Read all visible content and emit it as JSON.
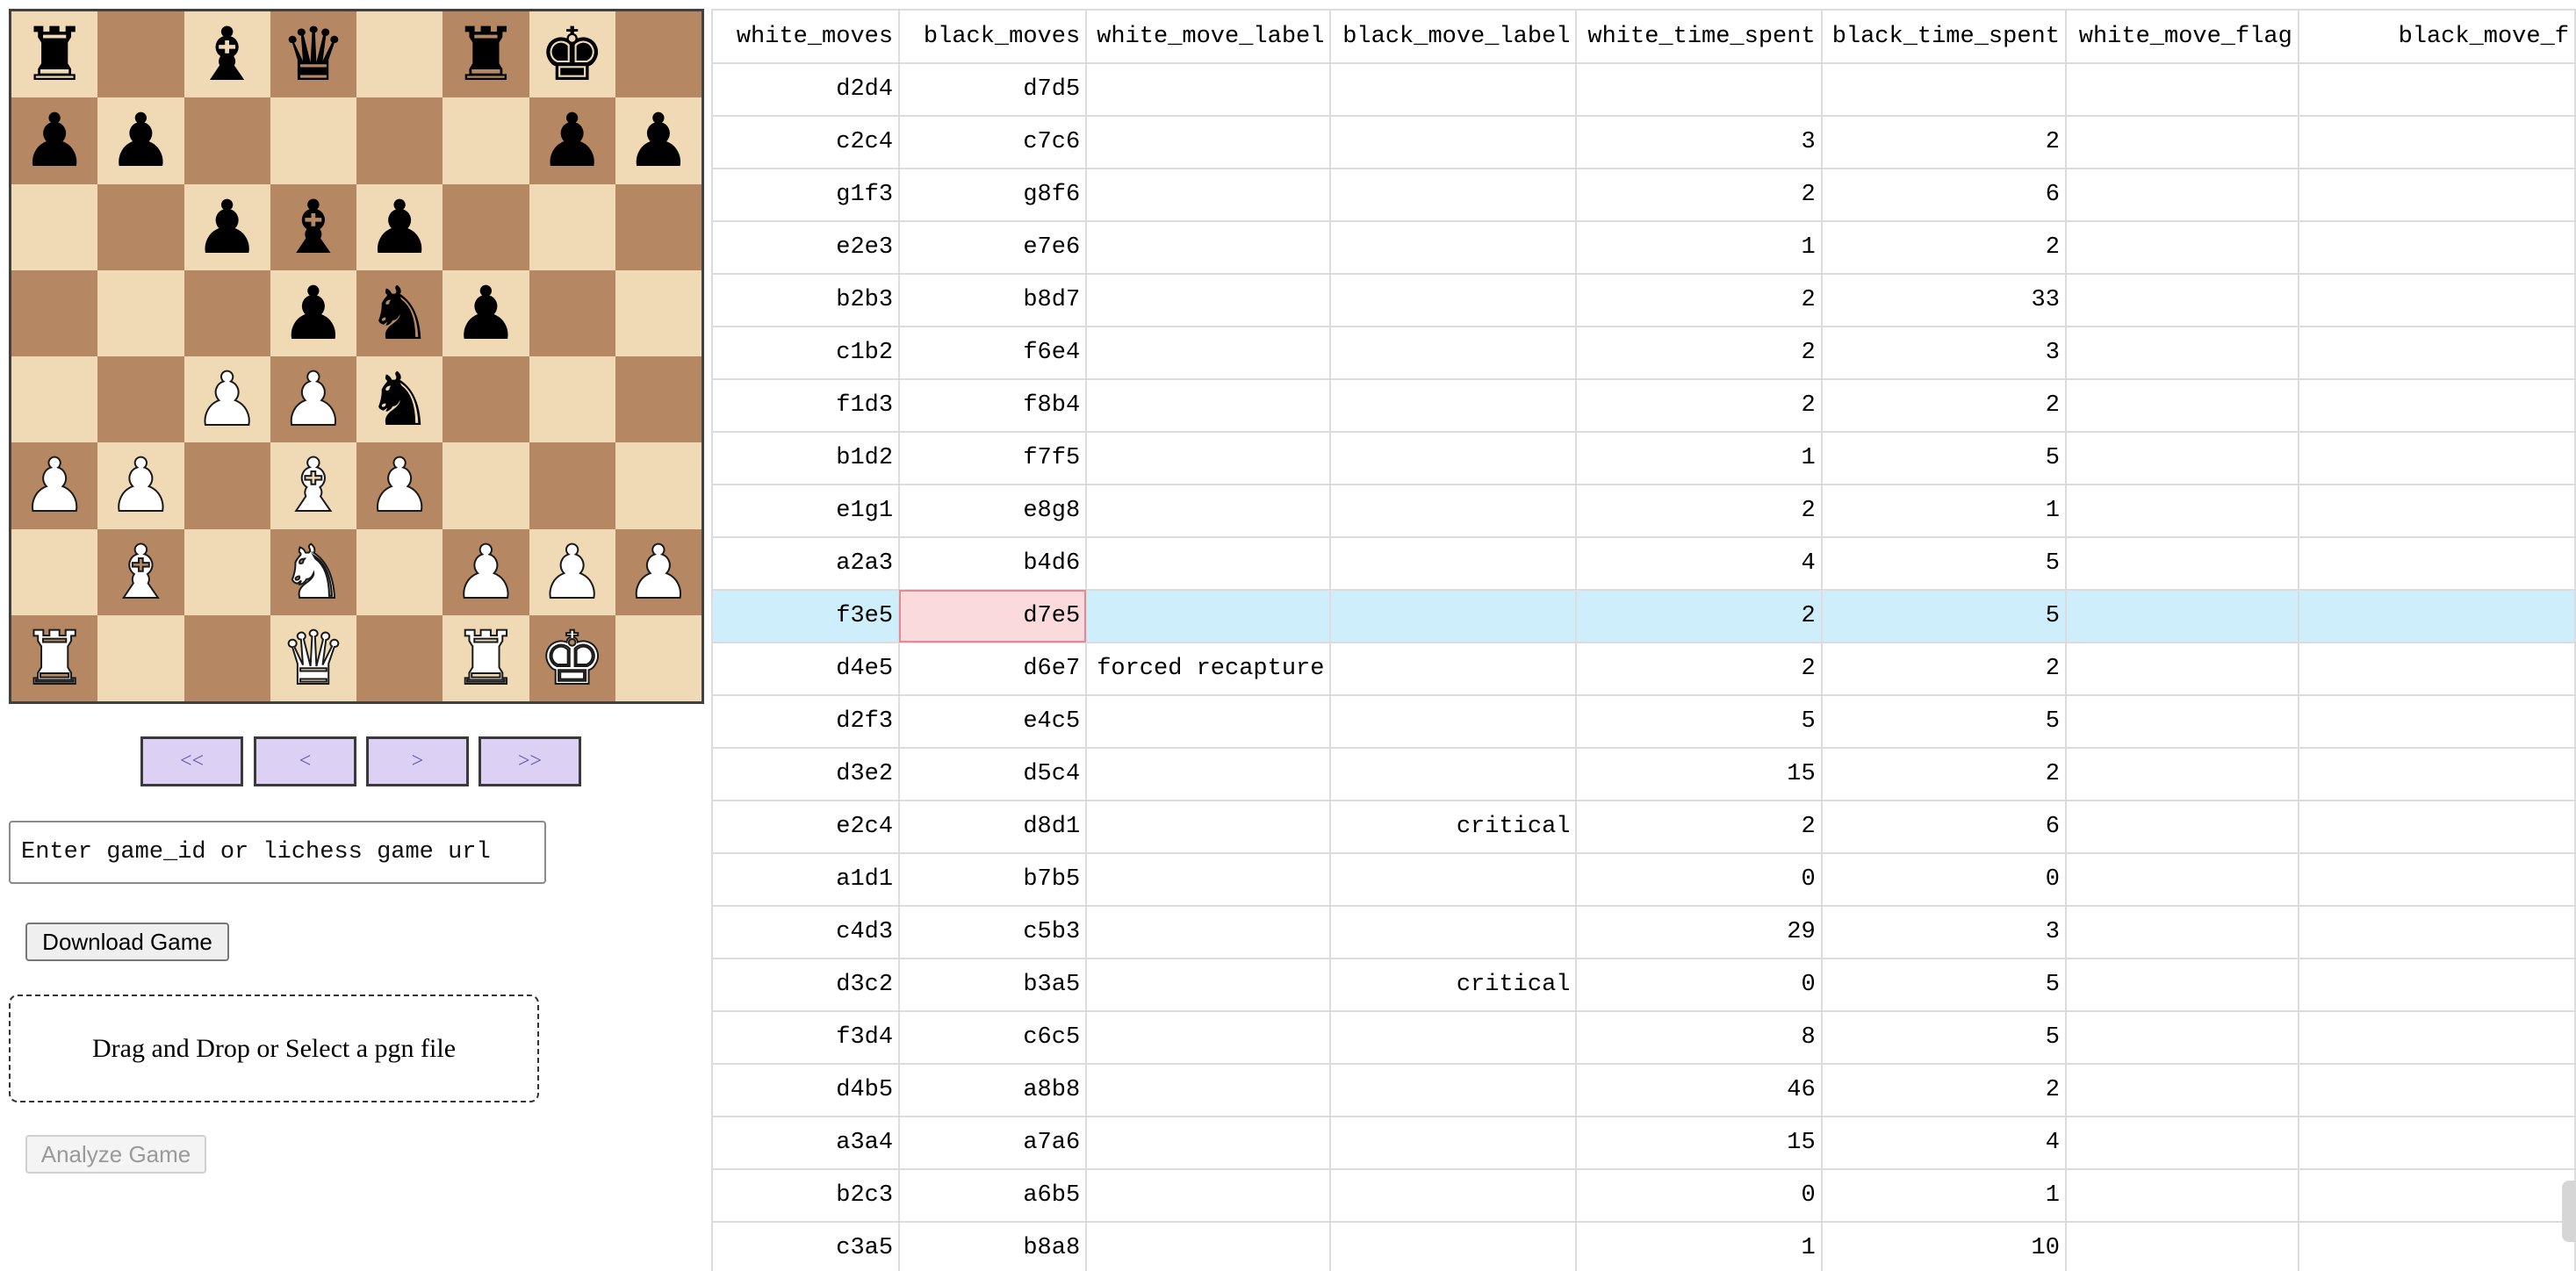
{
  "board": {
    "ranks": [
      [
        "br",
        "",
        "bb",
        "bq",
        "",
        "br",
        "bk",
        ""
      ],
      [
        "bp",
        "bp",
        "",
        "",
        "",
        "",
        "bp",
        "bp"
      ],
      [
        "",
        "",
        "bp",
        "bb",
        "bp",
        "",
        "",
        ""
      ],
      [
        "",
        "",
        "",
        "bp",
        "bn",
        "bp",
        "",
        ""
      ],
      [
        "",
        "",
        "wp",
        "wp",
        "bn",
        "",
        "",
        ""
      ],
      [
        "wp",
        "wp",
        "",
        "wb",
        "wp",
        "",
        "",
        ""
      ],
      [
        "",
        "wb",
        "",
        "wn",
        "",
        "wp",
        "wp",
        "wp"
      ],
      [
        "wr",
        "",
        "",
        "wq",
        "",
        "wr",
        "wk",
        ""
      ]
    ],
    "colors": {
      "light": "#f0d9b5",
      "dark": "#b58863"
    }
  },
  "nav": {
    "first": "<<",
    "prev": "<",
    "next": ">",
    "last": ">>"
  },
  "game_input": {
    "placeholder": "Enter game_id or lichess game url",
    "value": ""
  },
  "download_label": "Download Game",
  "dropzone_label": "Drag and Drop or Select a pgn file",
  "analyze_label": "Analyze Game",
  "table": {
    "columns": [
      "white_moves",
      "black_moves",
      "white_move_label",
      "black_move_label",
      "white_time_spent",
      "black_time_spent",
      "white_move_flag",
      "black_move_f"
    ],
    "rows": [
      [
        "d2d4",
        "d7d5",
        "",
        "",
        "",
        "",
        "",
        ""
      ],
      [
        "c2c4",
        "c7c6",
        "",
        "",
        "3",
        "2",
        "",
        ""
      ],
      [
        "g1f3",
        "g8f6",
        "",
        "",
        "2",
        "6",
        "",
        ""
      ],
      [
        "e2e3",
        "e7e6",
        "",
        "",
        "1",
        "2",
        "",
        ""
      ],
      [
        "b2b3",
        "b8d7",
        "",
        "",
        "2",
        "33",
        "",
        ""
      ],
      [
        "c1b2",
        "f6e4",
        "",
        "",
        "2",
        "3",
        "",
        ""
      ],
      [
        "f1d3",
        "f8b4",
        "",
        "",
        "2",
        "2",
        "",
        ""
      ],
      [
        "b1d2",
        "f7f5",
        "",
        "",
        "1",
        "5",
        "",
        ""
      ],
      [
        "e1g1",
        "e8g8",
        "",
        "",
        "2",
        "1",
        "",
        ""
      ],
      [
        "a2a3",
        "b4d6",
        "",
        "",
        "4",
        "5",
        "",
        ""
      ],
      [
        "f3e5",
        "d7e5",
        "",
        "",
        "2",
        "5",
        "",
        ""
      ],
      [
        "d4e5",
        "d6e7",
        "forced recapture",
        "",
        "2",
        "2",
        "",
        ""
      ],
      [
        "d2f3",
        "e4c5",
        "",
        "",
        "5",
        "5",
        "",
        ""
      ],
      [
        "d3e2",
        "d5c4",
        "",
        "",
        "15",
        "2",
        "",
        ""
      ],
      [
        "e2c4",
        "d8d1",
        "",
        "critical",
        "2",
        "6",
        "",
        ""
      ],
      [
        "a1d1",
        "b7b5",
        "",
        "",
        "0",
        "0",
        "",
        ""
      ],
      [
        "c4d3",
        "c5b3",
        "",
        "",
        "29",
        "3",
        "",
        ""
      ],
      [
        "d3c2",
        "b3a5",
        "",
        "critical",
        "0",
        "5",
        "",
        ""
      ],
      [
        "f3d4",
        "c6c5",
        "",
        "",
        "8",
        "5",
        "",
        ""
      ],
      [
        "d4b5",
        "a8b8",
        "",
        "",
        "46",
        "2",
        "",
        ""
      ],
      [
        "a3a4",
        "a7a6",
        "",
        "",
        "15",
        "4",
        "",
        ""
      ],
      [
        "b2c3",
        "a6b5",
        "",
        "",
        "0",
        "1",
        "",
        ""
      ],
      [
        "c3a5",
        "b8a8",
        "",
        "",
        "1",
        "10",
        "",
        ""
      ]
    ],
    "selected_row": 10,
    "focused_cell": [
      10,
      1
    ],
    "colors": {
      "selected_row": "#cdeefa",
      "focused_cell": "#fadada"
    }
  }
}
